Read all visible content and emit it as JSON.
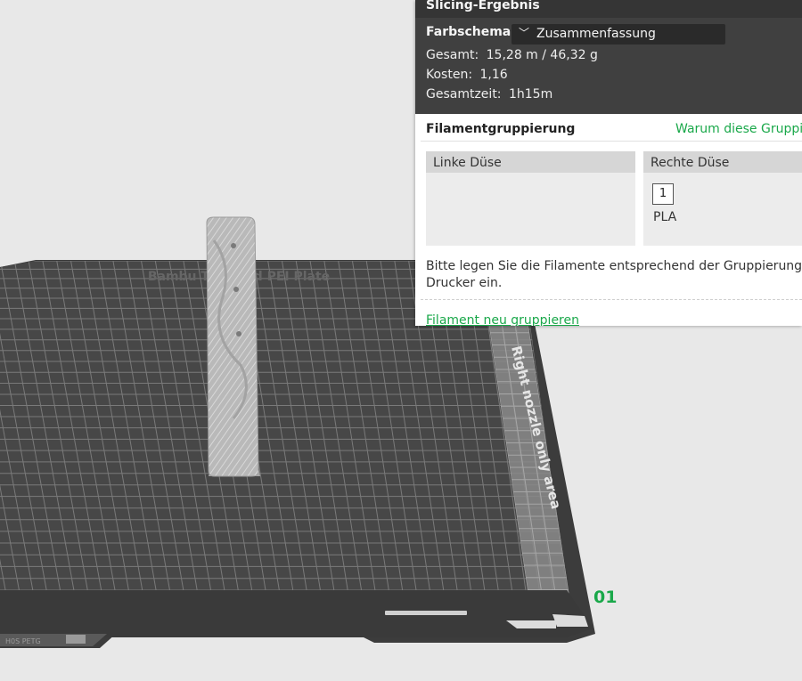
{
  "plate": {
    "plate_name": "Bambu Textured PEI Plate",
    "zone_label": "Right nozzle only area",
    "plate_number": "01",
    "corner_label": "H0S PETG"
  },
  "panel": {
    "title": "Slicing-Ergebnis",
    "color_scheme_label": "Farbschema",
    "color_scheme_chevron": "﹀",
    "color_scheme_value": "Zusammenfassung",
    "stats": [
      {
        "label": "Gesamt:",
        "value": "15,28 m / 46,32 g"
      },
      {
        "label": "Kosten:",
        "value": "1,16"
      },
      {
        "label": "Gesamtzeit:",
        "value": "1h15m"
      }
    ],
    "grouping_title": "Filamentgruppierung",
    "grouping_link": "Warum diese Gruppierung?",
    "left_nozzle": "Linke Düse",
    "right_nozzle": "Rechte Düse",
    "filament_index": "1",
    "filament_type": "PLA",
    "hint_line1": "Bitte legen Sie die Filamente entsprechend der Gruppierung in den",
    "hint_line2": "Drucker ein.",
    "regroup_link": "Filament neu gruppieren"
  },
  "colors": {
    "background": "#e8e8e8",
    "plate_dark": "#404040",
    "grid": "#7a7a7a",
    "accent_green": "#1aa84a",
    "panel_dark": "#404040"
  }
}
